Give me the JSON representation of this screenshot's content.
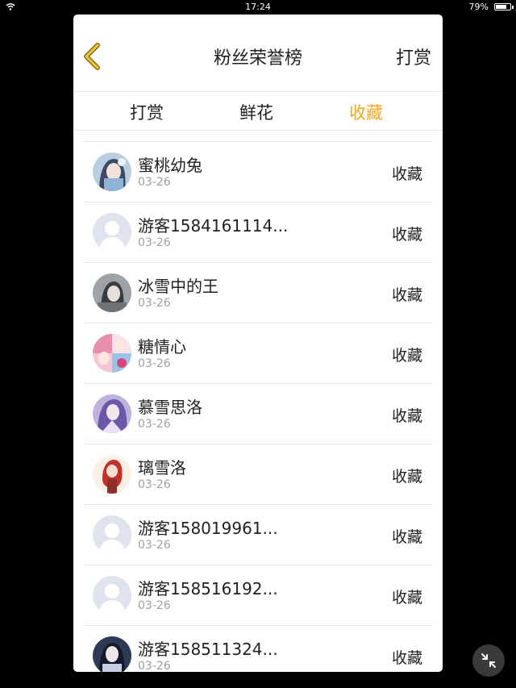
{
  "status_bar": {
    "time": "17:24",
    "battery": "79%",
    "battery_level": 0.79
  },
  "header": {
    "title": "粉丝荣誉榜",
    "action_label": "打赏",
    "accent_color": "#f5a623"
  },
  "tabs": [
    {
      "label": "打赏"
    },
    {
      "label": "鲜花"
    },
    {
      "label": "收藏"
    }
  ],
  "active_tab": 2,
  "fans": [
    {
      "name": "蜜桃幼兔",
      "date": "03-26",
      "status": "收藏",
      "avatar": "anime-girl-blue"
    },
    {
      "name": "游客1584161114...",
      "date": "03-26",
      "status": "收藏",
      "avatar": "default-user"
    },
    {
      "name": "冰雪中的王",
      "date": "03-26",
      "status": "收藏",
      "avatar": "anime-dark-grey"
    },
    {
      "name": "糖情心",
      "date": "03-26",
      "status": "收藏",
      "avatar": "anime-pink-collage"
    },
    {
      "name": "慕雪思洛",
      "date": "03-26",
      "status": "收藏",
      "avatar": "anime-purple"
    },
    {
      "name": "璃雪洛",
      "date": "03-26",
      "status": "收藏",
      "avatar": "anime-red-hair"
    },
    {
      "name": "游客158019961...",
      "date": "03-26",
      "status": "收藏",
      "avatar": "default-user"
    },
    {
      "name": "游客158516192...",
      "date": "03-26",
      "status": "收藏",
      "avatar": "default-user"
    },
    {
      "name": "游客158511324...",
      "date": "03-26",
      "status": "收藏",
      "avatar": "anime-dark-blue"
    }
  ]
}
